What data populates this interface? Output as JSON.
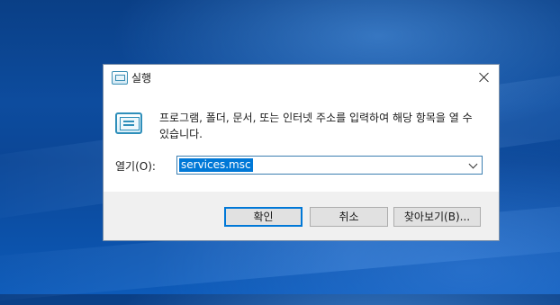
{
  "dialog": {
    "title": "실행",
    "description": "프로그램, 폴더, 문서, 또는 인터넷 주소를 입력하여 해당 항목을 열 수 있습니다.",
    "open_label": "열기(O):",
    "open_value": "services.msc",
    "ok_label": "확인",
    "cancel_label": "취소",
    "browse_label": "찾아보기(B)..."
  },
  "colors": {
    "accent": "#0078d7",
    "desktop": "#0b4696",
    "footer": "#f0f0f0"
  },
  "icons": {
    "title": "run-icon",
    "large": "run-icon",
    "close": "close-icon",
    "dropdown": "chevron-down-icon"
  }
}
